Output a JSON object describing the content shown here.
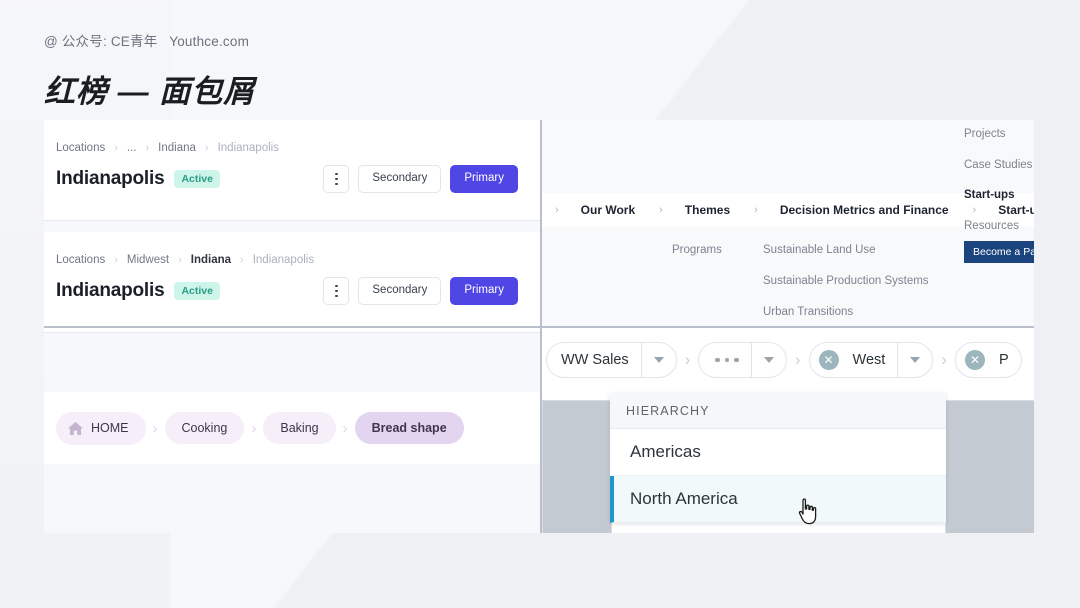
{
  "header": {
    "byline": "@ 公众号: CE青年   Youthce.com",
    "title": "红榜 — 面包屑"
  },
  "colors": {
    "primary": "#4f46e5",
    "badge_bg": "#cdf5ea",
    "badge_text": "#2a9d84",
    "pill_bg": "#f6eef9",
    "pill_active_bg": "#e3d5ef",
    "cta_blue": "#1b447e",
    "hier_accent": "#2196c9",
    "gray_block": "#c3cad2"
  },
  "left_panel": {
    "card_one": {
      "crumbs": [
        {
          "label": "Locations",
          "state": "normal"
        },
        {
          "label": "...",
          "state": "normal"
        },
        {
          "label": "Indiana",
          "state": "normal"
        },
        {
          "label": "Indianapolis",
          "state": "muted"
        }
      ],
      "separator": "›",
      "title": "Indianapolis",
      "badge": "Active",
      "kebab": "kebab-menu",
      "secondary_label": "Secondary",
      "primary_label": "Primary"
    },
    "card_two": {
      "crumbs": [
        {
          "label": "Locations",
          "state": "normal"
        },
        {
          "label": "Midwest",
          "state": "normal"
        },
        {
          "label": "Indiana",
          "state": "bold"
        },
        {
          "label": "Indianapolis",
          "state": "muted"
        }
      ],
      "separator": "›",
      "title": "Indianapolis",
      "badge": "Active",
      "kebab": "kebab-menu",
      "secondary_label": "Secondary",
      "primary_label": "Primary"
    },
    "pill_breadcrumb": {
      "separator": "›",
      "items": [
        {
          "label": "HOME",
          "icon": "home-icon",
          "active": false
        },
        {
          "label": "Cooking",
          "icon": "",
          "active": false
        },
        {
          "label": "Baking",
          "icon": "",
          "active": false
        },
        {
          "label": "Bread shape",
          "icon": "",
          "active": true
        }
      ]
    }
  },
  "right_panel": {
    "mega_menu": {
      "separator": "›",
      "trail": [
        {
          "label": "Our Work"
        },
        {
          "label": "Themes"
        },
        {
          "label": "Decision Metrics and Finance"
        },
        {
          "label": "Start-ups"
        }
      ],
      "col_programs": {
        "heading": "Programs"
      },
      "col_themes": [
        {
          "label": "Sustainable Land Use"
        },
        {
          "label": "Sustainable Production Systems"
        },
        {
          "label": "Urban Transitions"
        }
      ],
      "col_right_top": [
        {
          "label": "Projects"
        },
        {
          "label": "Case Studies"
        }
      ],
      "col_right_active": "Start-ups",
      "col_right_bottom": [
        {
          "label": "Resources"
        }
      ],
      "cta_label": "Become a Partner"
    },
    "filter_bar": {
      "separator": "›",
      "chips": [
        {
          "label": "WW Sales",
          "type": "text",
          "has_clear": false,
          "has_caret": true
        },
        {
          "label": "",
          "type": "ellipsis",
          "has_clear": false,
          "has_caret": true
        },
        {
          "label": "West",
          "type": "text",
          "has_clear": true,
          "has_caret": true
        },
        {
          "label": "P",
          "type": "text",
          "has_clear": true,
          "has_caret": false
        }
      ]
    },
    "hierarchy_dropdown": {
      "heading": "HIERARCHY",
      "rows": [
        {
          "label": "Americas",
          "selected": false
        },
        {
          "label": "North America",
          "selected": true
        }
      ],
      "cursor": "pointer-hand-cursor"
    }
  }
}
